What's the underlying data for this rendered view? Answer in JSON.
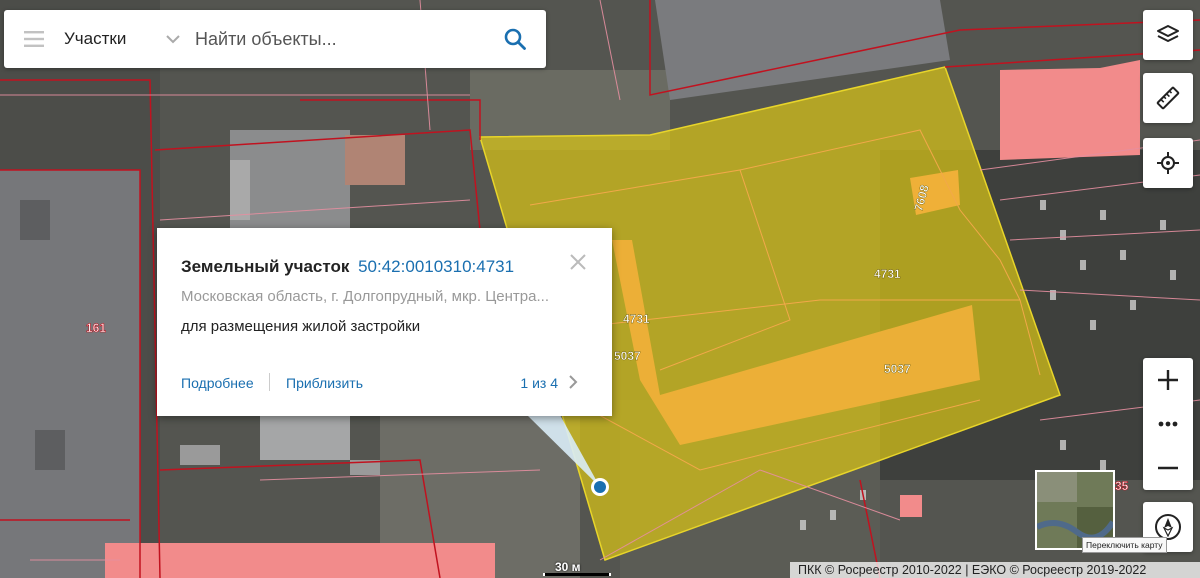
{
  "search": {
    "layer_label": "Участки",
    "placeholder": "Найти объекты..."
  },
  "popup": {
    "title": "Земельный участок",
    "cadastral_number": "50:42:0010310:4731",
    "address": "Московская область, г. Долгопрудный, мкр. Центра...",
    "usage": "для размещения жилой застройки",
    "more_link": "Подробнее",
    "zoom_link": "Приблизить",
    "pager": "1 из 4"
  },
  "map_labels": {
    "parcel_1": "4731",
    "parcel_2": "4731",
    "parcel_3": "5037",
    "parcel_4": "5037",
    "parcel_5": "7608",
    "building_left": "161",
    "building_right": "35"
  },
  "controls": {
    "layers": "layers-icon",
    "ruler": "ruler-icon",
    "locate": "crosshair-icon",
    "zoom_in": "+",
    "zoom_more": "•••",
    "zoom_out": "−",
    "compass": "compass-icon"
  },
  "scale_label": "30 м",
  "minimap_tooltip": "Переключить карту",
  "copyright": "ПКК © Росреестр 2010-2022 | ЕЭКО © Росреестр 2019-2022",
  "colors": {
    "parcel_fill": "#d8c416",
    "parcel_highlight": "#f6b13b",
    "building_pink": "#f28b8b",
    "boundary_red": "#c1121f",
    "link_blue": "#1a6fb0"
  }
}
